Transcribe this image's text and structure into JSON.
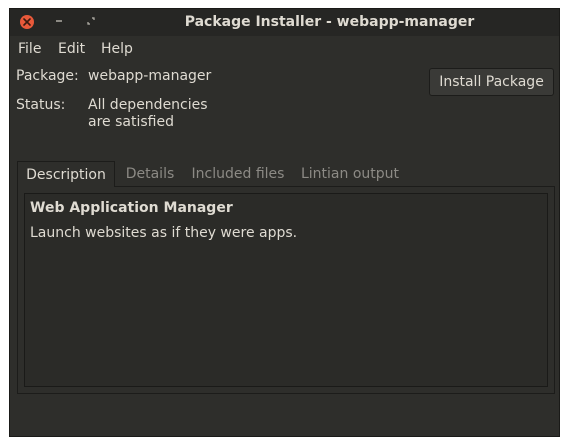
{
  "window": {
    "title": "Package Installer - webapp-manager"
  },
  "menubar": {
    "items": [
      "File",
      "Edit",
      "Help"
    ]
  },
  "info": {
    "package_label": "Package:",
    "package_value": "webapp-manager",
    "status_label": "Status:",
    "status_line1": "All dependencies",
    "status_line2": "are satisfied"
  },
  "actions": {
    "install_label": "Install Package"
  },
  "tabs": [
    {
      "label": "Description",
      "active": true
    },
    {
      "label": "Details",
      "active": false
    },
    {
      "label": "Included files",
      "active": false
    },
    {
      "label": "Lintian output",
      "active": false
    }
  ],
  "description": {
    "title": "Web Application Manager",
    "body": "Launch websites as if they were apps."
  },
  "colors": {
    "window_bg": "#2e2e2b",
    "titlebar_bg": "#262624",
    "close_button": "#e8593a",
    "text": "#dfdbd2",
    "inactive_tab_text": "#8c8a85"
  },
  "icons": {
    "close": "close-icon",
    "minimize": "minimize-icon",
    "maximize": "maximize-icon"
  }
}
